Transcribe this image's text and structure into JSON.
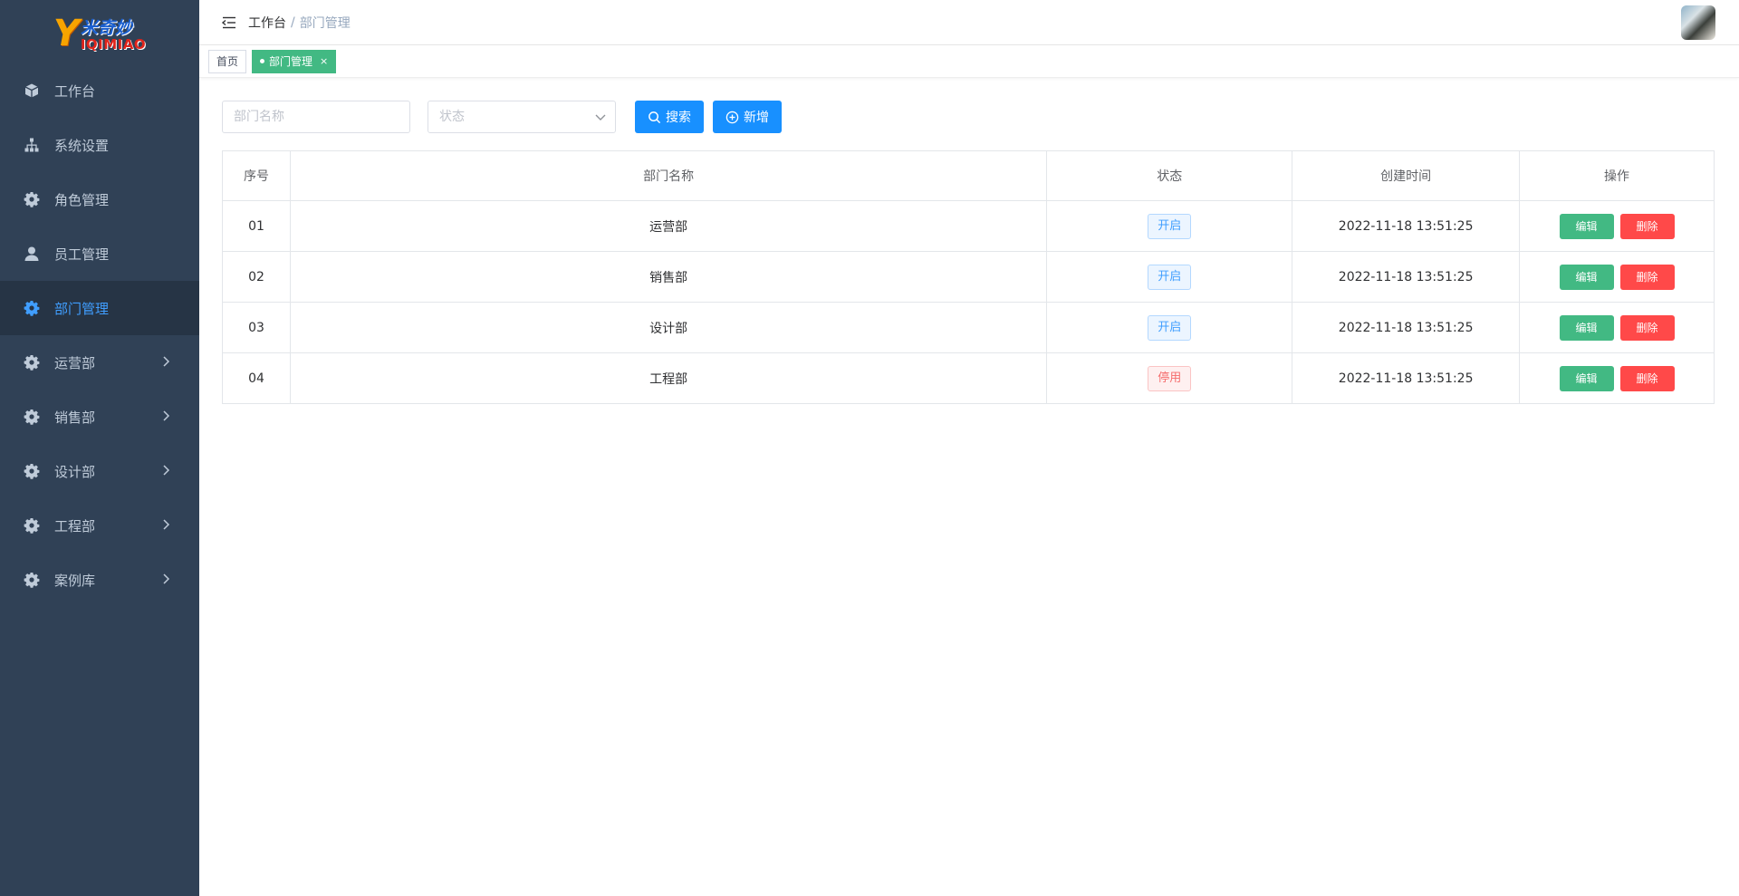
{
  "logo": {
    "mark": "Y",
    "cn": "米奇妙",
    "en": "IQIMIAO"
  },
  "sidebar": {
    "items": [
      {
        "label": "工作台",
        "icon": "cube-icon",
        "active": false,
        "expandable": false
      },
      {
        "label": "系统设置",
        "icon": "sitemap-icon",
        "active": false,
        "expandable": false
      },
      {
        "label": "角色管理",
        "icon": "gear-icon",
        "active": false,
        "expandable": false
      },
      {
        "label": "员工管理",
        "icon": "user-icon",
        "active": false,
        "expandable": false
      },
      {
        "label": "部门管理",
        "icon": "gear-icon",
        "active": true,
        "expandable": false
      },
      {
        "label": "运营部",
        "icon": "gear-icon",
        "active": false,
        "expandable": true
      },
      {
        "label": "销售部",
        "icon": "gear-icon",
        "active": false,
        "expandable": true
      },
      {
        "label": "设计部",
        "icon": "gear-icon",
        "active": false,
        "expandable": true
      },
      {
        "label": "工程部",
        "icon": "gear-icon",
        "active": false,
        "expandable": true
      },
      {
        "label": "案例库",
        "icon": "gear-icon",
        "active": false,
        "expandable": true
      }
    ]
  },
  "navbar": {
    "breadcrumb": {
      "home": "工作台",
      "separator": "/",
      "current": "部门管理"
    }
  },
  "tags": [
    {
      "label": "首页",
      "active": false
    },
    {
      "label": "部门管理",
      "active": true,
      "close": "×"
    }
  ],
  "filters": {
    "name_placeholder": "部门名称",
    "status_placeholder": "状态",
    "search_label": "搜索",
    "add_label": "新增"
  },
  "table": {
    "headers": [
      "序号",
      "部门名称",
      "状态",
      "创建时间",
      "操作"
    ],
    "rows": [
      {
        "no": "01",
        "name": "运营部",
        "status": "开启",
        "status_type": "on",
        "created": "2022-11-18  13:51:25"
      },
      {
        "no": "02",
        "name": "销售部",
        "status": "开启",
        "status_type": "on",
        "created": "2022-11-18  13:51:25"
      },
      {
        "no": "03",
        "name": "设计部",
        "status": "开启",
        "status_type": "on",
        "created": "2022-11-18  13:51:25"
      },
      {
        "no": "04",
        "name": "工程部",
        "status": "停用",
        "status_type": "off",
        "created": "2022-11-18  13:51:25"
      }
    ],
    "edit_label": "编辑",
    "delete_label": "删除"
  },
  "colors": {
    "sidebar_bg": "#304156",
    "sidebar_active": "#409eff",
    "primary": "#1890ff",
    "tag_active": "#42b983",
    "danger": "#ff4949"
  }
}
